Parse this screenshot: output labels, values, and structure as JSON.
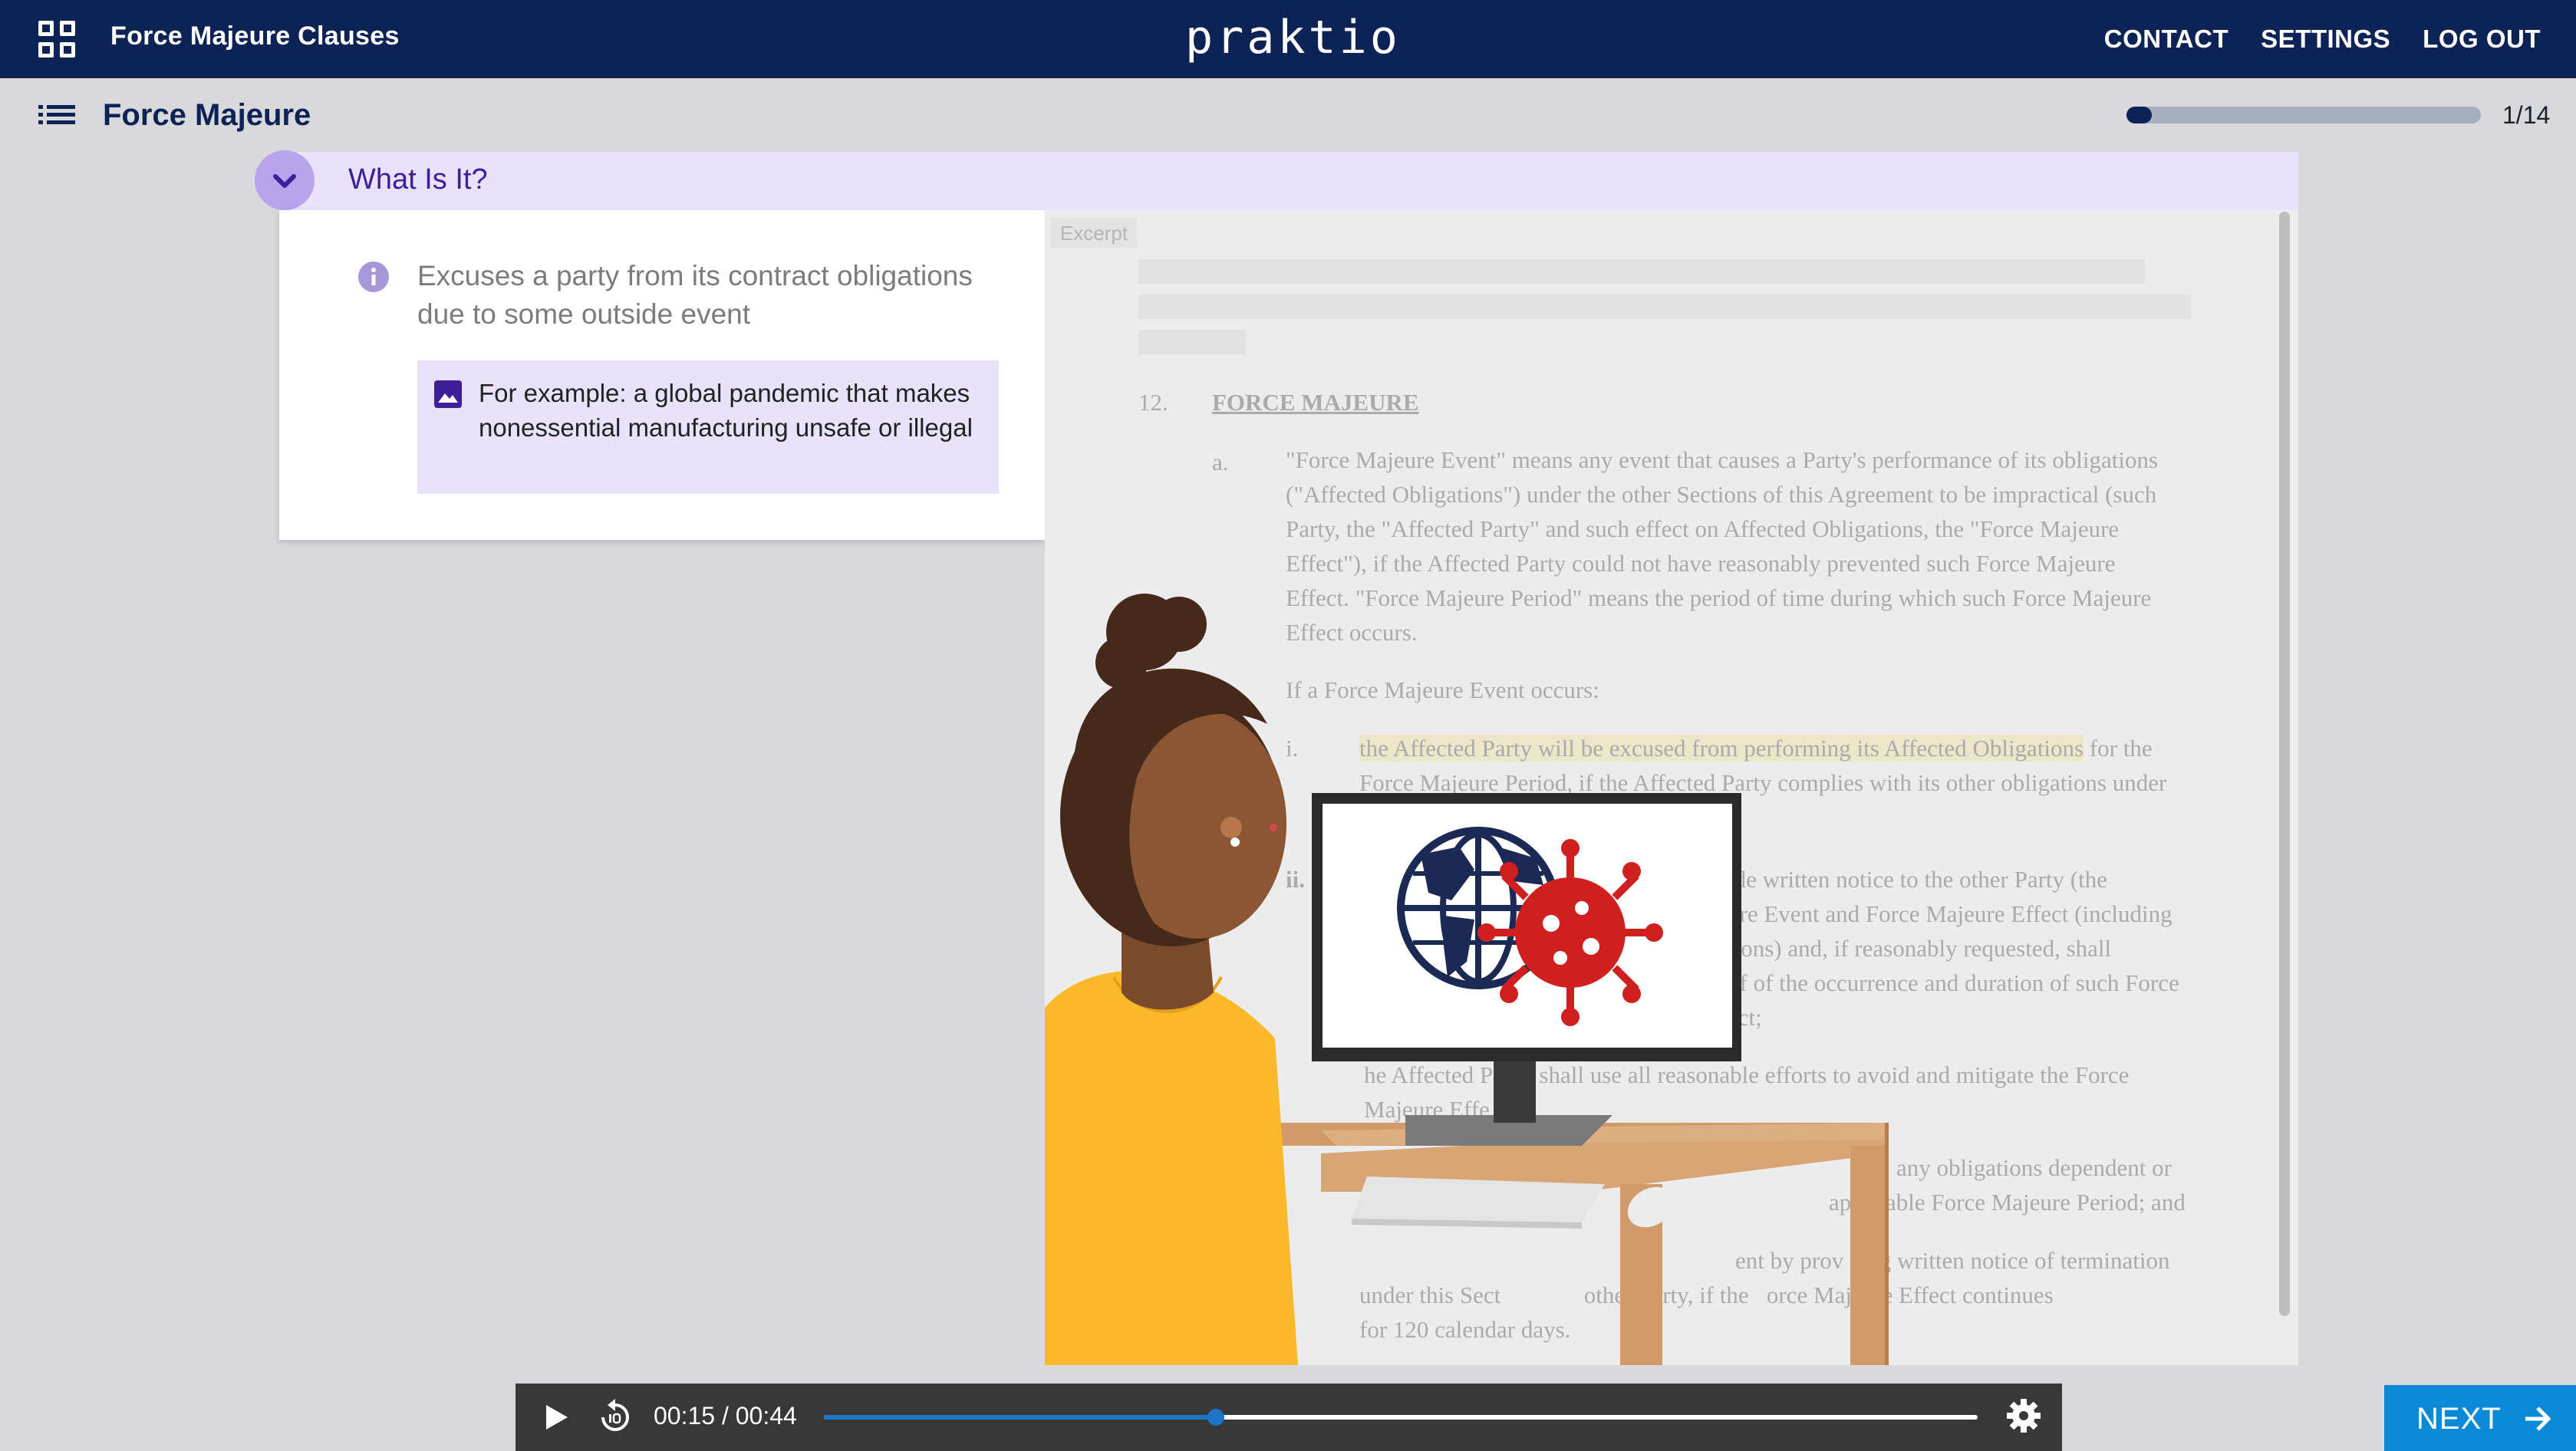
{
  "topbar": {
    "course_title": "Force Majeure Clauses",
    "brand": "praktio",
    "nav": [
      "CONTACT",
      "SETTINGS",
      "LOG OUT"
    ],
    "icon": "grid-icon"
  },
  "subheader": {
    "module_title": "Force Majeure",
    "progress_fraction": 0.0714,
    "progress_label": "1/14",
    "icon": "list-icon"
  },
  "section": {
    "title": "What Is It?",
    "definition": "Excuses a party from its contract obligations due to some outside event",
    "example": "For example: a global pandemic that makes nonessential manufacturing unsafe or illegal"
  },
  "excerpt": {
    "tag": "Excerpt",
    "section_number": "12.",
    "section_heading": "FORCE MAJEURE",
    "item_a_label": "a.",
    "item_a_lines": [
      "\"Force Majeure Event\" means any event that causes a Party's performance of its obligations",
      "(\"Affected Obligations\") under the other Sections of this Agreement to be impractical (such",
      "Party, the \"Affected Party\" and such effect on Affected Obligations, the \"Force Majeure",
      "Effect\"), if the Affected Party could not have reasonably prevented such Force Majeure",
      "Effect. \"Force Majeure Period\" means the period of time during which such Force Majeure",
      "Effect occurs."
    ],
    "if_occurs": "If a Force Majeure Event occurs:",
    "item_i_label": "i.",
    "item_i_highlight": "the Affected Party will be excused from performing its Affected Obligations",
    "item_i_rest": " for the",
    "item_i_line2": "Force Majeure Period, if the Affected Party complies with its other obligations under",
    "item_ii_label": "ii.",
    "item_ii_lines": [
      "ide written notice to the other Party (the",
      "ure Event and Force Majeure Effect (including",
      "tions) and, if reasonably requested, shall",
      "of of the occurrence and duration of such Force",
      "ect;"
    ],
    "item_iii_line": "he Affected Pa      shall use all reasonable efforts to avoid and mitigate the Force",
    "item_iii_line2": "Majeure Effe",
    "item_iv_lines": [
      "any obligations dependent or",
      "ap    cable Force Majeure Period; and"
    ],
    "item_v_lines": [
      "ent by prov    ng written notice of termination",
      "under this Sect              other Party, if the   orce Majeure Effect continues",
      "for 120 calendar days."
    ]
  },
  "video": {
    "time": "00:15 / 00:44",
    "progress_fraction": 0.34,
    "icons": [
      "play-icon",
      "replay-10-icon",
      "gear-icon"
    ]
  },
  "next": {
    "label": "NEXT",
    "icon": "arrow-right-icon"
  },
  "colors": {
    "topbar": "#0d2356",
    "accent_purple": "#3d1f9a",
    "section_bg": "#e8e2fb",
    "next_blue": "#0a8ad6",
    "video_bar": "#383838",
    "seek_blue": "#1b76c8"
  }
}
